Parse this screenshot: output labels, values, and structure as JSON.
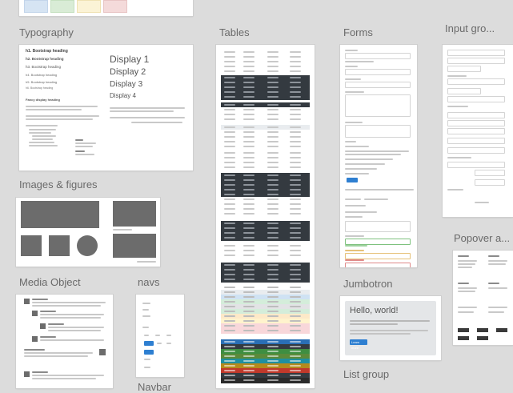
{
  "sections": {
    "typography": "Typography",
    "tables": "Tables",
    "forms": "Forms",
    "input_groups": "Input gro...",
    "images_figures": "Images & figures",
    "media_object": "Media Object",
    "navs": "navs",
    "navbar": "Navbar",
    "jumbotron": "Jumbotron",
    "list_group": "List group",
    "popover": "Popover a..."
  },
  "typography_card": {
    "headings": [
      "h1. Bootstrap heading",
      "h2. Bootstrap heading",
      "h3. Bootstrap heading",
      "h4. Bootstrap heading",
      "h5. Bootstrap heading",
      "h6. Bootstrap heading"
    ],
    "displays": [
      "Display 1",
      "Display 2",
      "Display 3",
      "Display 4"
    ],
    "fancy": "Fancy display heading"
  },
  "jumbotron_card": {
    "title": "Hello, world!",
    "button": "Learn more"
  },
  "colors": {
    "canvas": "#dcdcdc",
    "table_dark": "#343a40",
    "primary": "#2e7fd1"
  }
}
